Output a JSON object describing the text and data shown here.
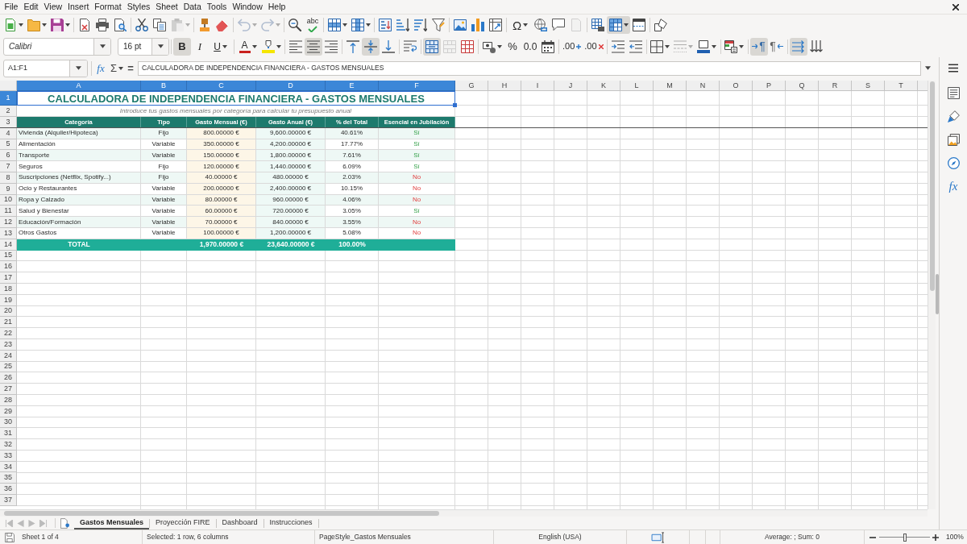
{
  "menu": [
    "File",
    "Edit",
    "View",
    "Insert",
    "Format",
    "Styles",
    "Sheet",
    "Data",
    "Tools",
    "Window",
    "Help"
  ],
  "standard_toolbar": {
    "paste": {
      "disabled": true
    },
    "undo": {
      "disabled": true
    },
    "redo": {
      "disabled": true
    },
    "spelling": {
      "label": "abc"
    },
    "special_character": {
      "label": "Ω"
    },
    "headers_footers": {
      "disabled": true
    },
    "freeze_rows_columns": {
      "pressed": true
    }
  },
  "formatting_toolbar": {
    "font_name": "Calibri",
    "font_size": "16 pt",
    "bold": {
      "label": "B",
      "pressed": true
    },
    "italic": {
      "label": "I",
      "pressed": false
    },
    "underline": {
      "label": "U",
      "pressed": false
    },
    "font_color": {
      "label": "A"
    },
    "align_center": {
      "pressed": true
    },
    "align_middle": {
      "pressed": true
    },
    "merge_and_center": {
      "pressed": true
    },
    "merge_cells": {
      "disabled": true
    },
    "percent": {
      "label": "%"
    },
    "standard_format": {
      "label": "0.0"
    },
    "add_decimal": {
      "label": ".00"
    },
    "delete_decimal": {
      "label": ".00"
    },
    "border_style": {
      "disabled": true
    },
    "left_to_right": {
      "label": "¶",
      "pressed": true
    },
    "right_to_left": {
      "label": "¶",
      "pressed": false
    },
    "text_left_to_right": {
      "pressed": true
    }
  },
  "formula_bar": {
    "name_box": "A1:F1",
    "function_wizard": "fx",
    "sum": "Σ",
    "formula_button": "=",
    "content": "CALCULADORA DE INDEPENDENCIA FINANCIERA - GASTOS MENSUALES"
  },
  "sheet": {
    "column_headers": [
      {
        "label": "A",
        "selected": true
      },
      {
        "label": "B",
        "selected": true
      },
      {
        "label": "C",
        "selected": true
      },
      {
        "label": "D",
        "selected": true
      },
      {
        "label": "E",
        "selected": true
      },
      {
        "label": "F",
        "selected": true
      },
      {
        "label": "G",
        "selected": false
      },
      {
        "label": "H",
        "selected": false
      },
      {
        "label": "I",
        "selected": false
      },
      {
        "label": "J",
        "selected": false
      },
      {
        "label": "K",
        "selected": false
      },
      {
        "label": "L",
        "selected": false
      },
      {
        "label": "M",
        "selected": false
      },
      {
        "label": "N",
        "selected": false
      },
      {
        "label": "O",
        "selected": false
      },
      {
        "label": "P",
        "selected": false
      },
      {
        "label": "Q",
        "selected": false
      },
      {
        "label": "R",
        "selected": false
      },
      {
        "label": "S",
        "selected": false
      },
      {
        "label": "T",
        "selected": false
      }
    ],
    "row_headers": [
      {
        "label": "1",
        "selected": true
      },
      {
        "label": "2",
        "selected": false
      },
      {
        "label": "3",
        "selected": false
      },
      {
        "label": "4",
        "selected": false
      },
      {
        "label": "5",
        "selected": false
      },
      {
        "label": "6",
        "selected": false
      },
      {
        "label": "7",
        "selected": false
      },
      {
        "label": "8",
        "selected": false
      },
      {
        "label": "9",
        "selected": false
      },
      {
        "label": "10",
        "selected": false
      },
      {
        "label": "11",
        "selected": false
      },
      {
        "label": "12",
        "selected": false
      },
      {
        "label": "13",
        "selected": false
      },
      {
        "label": "14",
        "selected": false
      },
      {
        "label": "15",
        "selected": false
      },
      {
        "label": "16",
        "selected": false
      },
      {
        "label": "17",
        "selected": false
      },
      {
        "label": "18",
        "selected": false
      },
      {
        "label": "19",
        "selected": false
      },
      {
        "label": "20",
        "selected": false
      },
      {
        "label": "21",
        "selected": false
      },
      {
        "label": "22",
        "selected": false
      },
      {
        "label": "23",
        "selected": false
      },
      {
        "label": "24",
        "selected": false
      },
      {
        "label": "25",
        "selected": false
      },
      {
        "label": "26",
        "selected": false
      },
      {
        "label": "27",
        "selected": false
      },
      {
        "label": "28",
        "selected": false
      },
      {
        "label": "29",
        "selected": false
      },
      {
        "label": "30",
        "selected": false
      },
      {
        "label": "31",
        "selected": false
      },
      {
        "label": "32",
        "selected": false
      },
      {
        "label": "33",
        "selected": false
      },
      {
        "label": "34",
        "selected": false
      },
      {
        "label": "35",
        "selected": false
      },
      {
        "label": "36",
        "selected": false
      },
      {
        "label": "37",
        "selected": false
      }
    ],
    "title": {
      "text": "CALCULADORA DE INDEPENDENCIA FINANCIERA - GASTOS MENSUALES",
      "selected": true
    },
    "subtitle": "Introduce tus gastos mensuales por categoría para calcular tu presupuesto anual",
    "table_headers": [
      "Categoría",
      "Tipo",
      "Gasto Mensual (€)",
      "Gasto Anual (€)",
      "% del Total",
      "Esencial en Jubilación"
    ],
    "rows": [
      {
        "category": "Vivienda (Alquiler/Hipoteca)",
        "type": "Fijo",
        "monthly": "800.00000 €",
        "annual": "9,600.00000 €",
        "share": "40.61%",
        "essential": "Sí",
        "essential_yes": true
      },
      {
        "category": "Alimentación",
        "type": "Variable",
        "monthly": "350.00000 €",
        "annual": "4,200.00000 €",
        "share": "17.77%",
        "essential": "Sí",
        "essential_yes": true
      },
      {
        "category": "Transporte",
        "type": "Variable",
        "monthly": "150.00000 €",
        "annual": "1,800.00000 €",
        "share": "7.61%",
        "essential": "Sí",
        "essential_yes": true
      },
      {
        "category": "Seguros",
        "type": "Fijo",
        "monthly": "120.00000 €",
        "annual": "1,440.00000 €",
        "share": "6.09%",
        "essential": "Sí",
        "essential_yes": true
      },
      {
        "category": "Suscripciones (Netflix, Spotify...)",
        "type": "Fijo",
        "monthly": "40.00000 €",
        "annual": "480.00000 €",
        "share": "2.03%",
        "essential": "No",
        "essential_yes": false
      },
      {
        "category": "Ocio y Restaurantes",
        "type": "Variable",
        "monthly": "200.00000 €",
        "annual": "2,400.00000 €",
        "share": "10.15%",
        "essential": "No",
        "essential_yes": false
      },
      {
        "category": "Ropa y Calzado",
        "type": "Variable",
        "monthly": "80.00000 €",
        "annual": "960.00000 €",
        "share": "4.06%",
        "essential": "No",
        "essential_yes": false
      },
      {
        "category": "Salud y Bienestar",
        "type": "Variable",
        "monthly": "60.00000 €",
        "annual": "720.00000 €",
        "share": "3.05%",
        "essential": "Sí",
        "essential_yes": true
      },
      {
        "category": "Educación/Formación",
        "type": "Variable",
        "monthly": "70.00000 €",
        "annual": "840.00000 €",
        "share": "3.55%",
        "essential": "No",
        "essential_yes": false
      },
      {
        "category": "Otros Gastos",
        "type": "Variable",
        "monthly": "100.00000 €",
        "annual": "1,200.00000 €",
        "share": "5.08%",
        "essential": "No",
        "essential_yes": false
      }
    ],
    "total": {
      "label": "TOTAL",
      "monthly": "1,970.00000 €",
      "annual": "23,640.00000 €",
      "share": "100.00%"
    }
  },
  "sheet_tabs": [
    {
      "label": "Gastos Mensuales",
      "selected": true
    },
    {
      "label": "Proyección FIRE",
      "selected": false
    },
    {
      "label": "Dashboard",
      "selected": false
    },
    {
      "label": "Instrucciones",
      "selected": false
    }
  ],
  "sidebar": {
    "functions": "fx"
  },
  "status_bar": {
    "sheet": "Sheet 1 of 4",
    "selection": "Selected: 1 row, 6 columns",
    "page_style": "PageStyle_Gastos Mensuales",
    "language": "English (USA)",
    "summary": "Average: ; Sum: 0",
    "zoom": {
      "level": 0.5,
      "label": "100%"
    }
  }
}
